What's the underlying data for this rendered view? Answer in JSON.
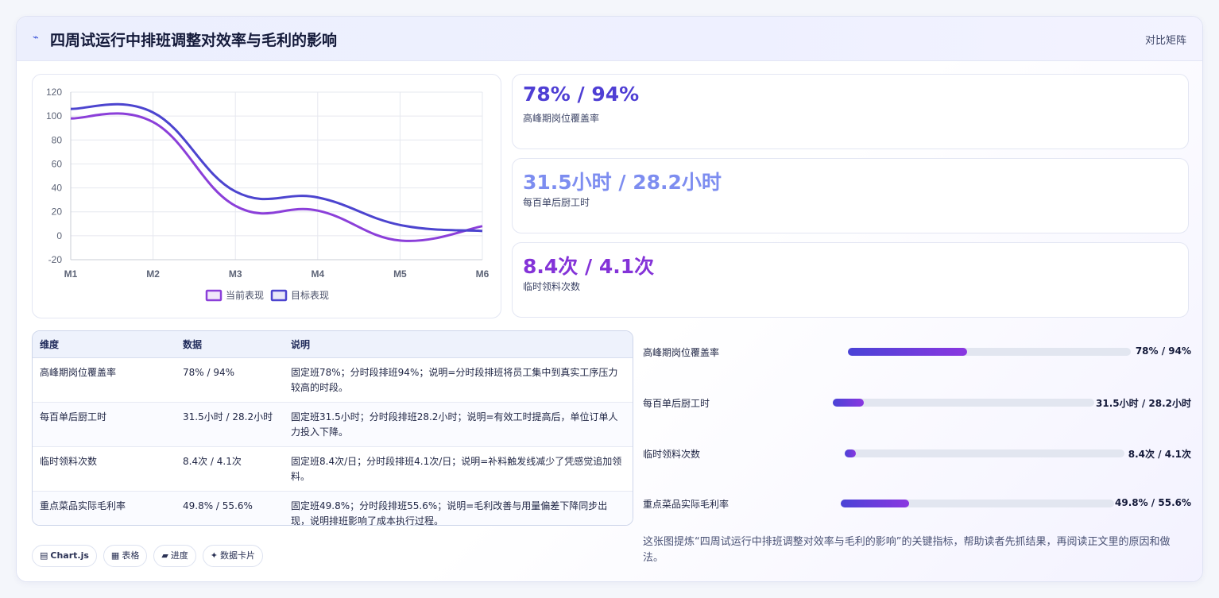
{
  "header": {
    "icon": "trend-line-icon",
    "title": "四周试运行中排班调整对效率与毛利的影响",
    "tag": "对比矩阵"
  },
  "chart_data": {
    "type": "line",
    "categories": [
      "M1",
      "M2",
      "M3",
      "M4",
      "M5",
      "M6"
    ],
    "ylim": [
      -20,
      120
    ],
    "yticks": [
      -20,
      0,
      20,
      40,
      60,
      80,
      100,
      120
    ],
    "grid": true,
    "legend_position": "bottom",
    "series": [
      {
        "name": "当前表现",
        "color": "#8b3fd9",
        "values": [
          98,
          95,
          25,
          21,
          -4,
          8
        ]
      },
      {
        "name": "目标表现",
        "color": "#4c44cf",
        "values": [
          106,
          103,
          37,
          32,
          9,
          4
        ]
      }
    ]
  },
  "kpis": [
    {
      "value": "78% / 94%",
      "label": "高峰期岗位覆盖率",
      "color": "#4f3fd4"
    },
    {
      "value": "31.5小时 / 28.2小时",
      "label": "每百单后厨工时",
      "color": "#7d8df0"
    },
    {
      "value": "8.4次 / 4.1次",
      "label": "临时领料次数",
      "color": "#8433d8"
    }
  ],
  "table": {
    "headers": [
      "维度",
      "数据",
      "说明"
    ],
    "rows": [
      [
        "高峰期岗位覆盖率",
        "78% / 94%",
        "固定班78%；分时段排班94%；说明=分时段排班将员工集中到真实工序压力较高的时段。"
      ],
      [
        "每百单后厨工时",
        "31.5小时 / 28.2小时",
        "固定班31.5小时；分时段排班28.2小时；说明=有效工时提高后，单位订单人力投入下降。"
      ],
      [
        "临时领料次数",
        "8.4次 / 4.1次",
        "固定班8.4次/日；分时段排班4.1次/日；说明=补料触发线减少了凭感觉追加领料。"
      ],
      [
        "重点菜品实际毛利率",
        "49.8% / 55.6%",
        "固定班49.8%；分时段排班55.6%；说明=毛利改善与用量偏差下降同步出现，说明排班影响了成本执行过程。"
      ]
    ]
  },
  "progress": [
    {
      "label": "高峰期岗位覆盖率",
      "value": "78% / 94%",
      "fill": 0.42
    },
    {
      "label": "每百单后厨工时",
      "value": "31.5小时 / 28.2小时",
      "fill": 0.12
    },
    {
      "label": "临时领料次数",
      "value": "8.4次 / 4.1次",
      "fill": 0.04
    },
    {
      "label": "重点菜品实际毛利率",
      "value": "49.8% / 55.6%",
      "fill": 0.25
    }
  ],
  "summary": "这张图提炼“四周试运行中排班调整对效率与毛利的影响”的关键指标，帮助读者先抓结果，再阅读正文里的原因和做法。",
  "chips": [
    {
      "icon": "chart-icon",
      "glyph": "▤",
      "label": "Chart.js"
    },
    {
      "icon": "table-icon",
      "glyph": "▦",
      "label": "表格"
    },
    {
      "icon": "progress-icon",
      "glyph": "▰",
      "label": "进度"
    },
    {
      "icon": "card-icon",
      "glyph": "✦",
      "label": "数据卡片"
    }
  ]
}
